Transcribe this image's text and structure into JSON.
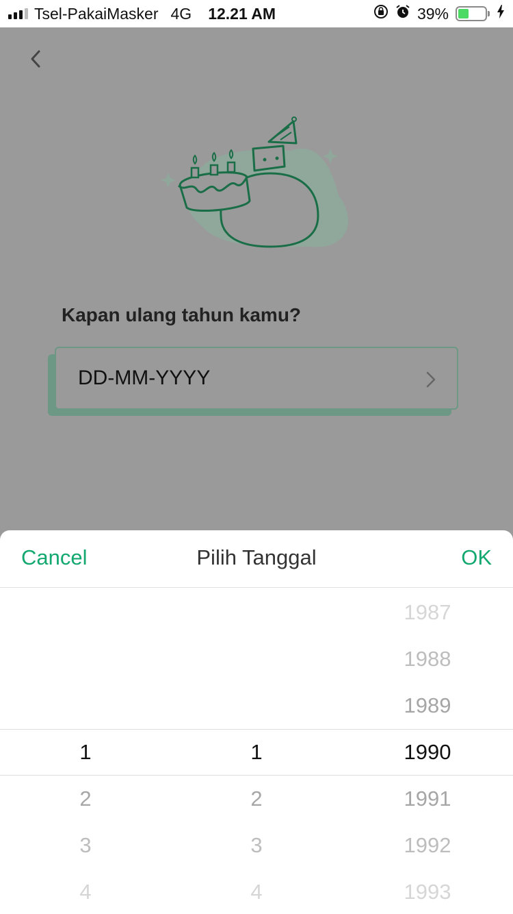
{
  "status_bar": {
    "carrier": "Tsel-PakaiMasker",
    "network": "4G",
    "time": "12.21 AM",
    "battery_percent": "39%",
    "battery_level": 0.39
  },
  "page": {
    "question": "Kapan ulang tahun kamu?",
    "date_field_placeholder": "DD-MM-YYYY"
  },
  "picker_sheet": {
    "cancel_label": "Cancel",
    "title": "Pilih Tanggal",
    "ok_label": "OK",
    "days": [
      "1",
      "2",
      "3",
      "4"
    ],
    "months": [
      "1",
      "2",
      "3",
      "4"
    ],
    "years": [
      "1987",
      "1988",
      "1989",
      "1990",
      "1991",
      "1992",
      "1993"
    ],
    "selected": {
      "day": "1",
      "month": "1",
      "year": "1990"
    }
  },
  "colors": {
    "accent": "#13a870",
    "overlay": "#9a9a9a",
    "field_border": "#6d9885"
  },
  "icons": [
    "back-chevron-icon",
    "chevron-right-icon",
    "birthday-cake-illustration",
    "orientation-lock-icon",
    "alarm-icon",
    "charging-icon"
  ]
}
